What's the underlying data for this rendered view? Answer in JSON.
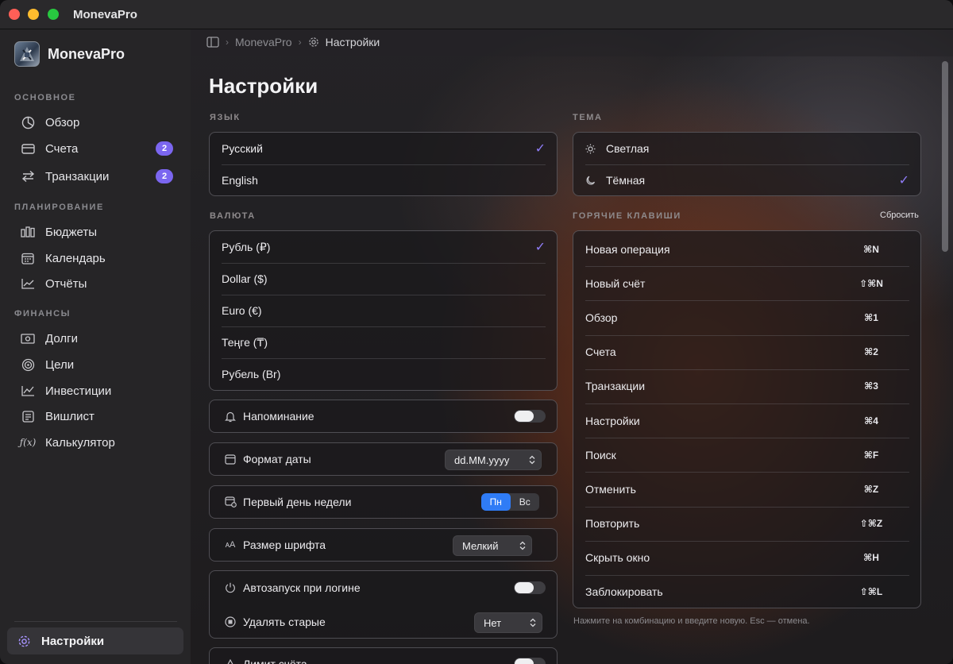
{
  "app": {
    "title": "MonevaPro"
  },
  "sidebar": {
    "brand": "MonevaPro",
    "sections": [
      {
        "title": "ОСНОВНОЕ",
        "items": [
          {
            "label": "Обзор",
            "icon": "pie-chart-icon"
          },
          {
            "label": "Счета",
            "icon": "card-icon",
            "badge": "2"
          },
          {
            "label": "Транзакции",
            "icon": "arrows-icon",
            "badge": "2"
          }
        ]
      },
      {
        "title": "ПЛАНИРОВАНИЕ",
        "items": [
          {
            "label": "Бюджеты",
            "icon": "bars-icon"
          },
          {
            "label": "Календарь",
            "icon": "calendar-icon"
          },
          {
            "label": "Отчёты",
            "icon": "line-chart-icon"
          }
        ]
      },
      {
        "title": "ФИНАНСЫ",
        "items": [
          {
            "label": "Долги",
            "icon": "banknote-icon"
          },
          {
            "label": "Цели",
            "icon": "target-icon"
          },
          {
            "label": "Инвестиции",
            "icon": "trend-icon"
          },
          {
            "label": "Вишлист",
            "icon": "list-icon"
          },
          {
            "label": "Калькулятор",
            "icon": "function-icon"
          }
        ]
      }
    ],
    "settings_label": "Настройки"
  },
  "breadcrumb": {
    "root": "MonevaPro",
    "current": "Настройки"
  },
  "page": {
    "title": "Настройки"
  },
  "language": {
    "title": "ЯЗЫК",
    "options": [
      "Русский",
      "English"
    ],
    "selected": "Русский"
  },
  "theme": {
    "title": "ТЕМА",
    "options": [
      "Светлая",
      "Тёмная"
    ],
    "selected": "Тёмная"
  },
  "currency": {
    "title": "ВАЛЮТА",
    "options": [
      "Рубль (₽)",
      "Dollar ($)",
      "Euro (€)",
      "Теңге (₸)",
      "Рубель (Br)"
    ],
    "selected": "Рубль (₽)"
  },
  "settings": {
    "reminder": {
      "label": "Напоминание",
      "enabled": false
    },
    "date_format": {
      "label": "Формат даты",
      "value": "dd.MM.yyyy"
    },
    "first_day": {
      "label": "Первый день недели",
      "options": [
        "Пн",
        "Вс"
      ],
      "selected": "Пн"
    },
    "font_size": {
      "label": "Размер шрифта",
      "value": "Мелкий"
    },
    "autostart": {
      "label": "Автозапуск при логине",
      "enabled": false
    },
    "delete_old": {
      "label": "Удалять старые",
      "value": "Нет"
    },
    "account_limit": {
      "label": "Лимит счёта"
    }
  },
  "hotkeys": {
    "title": "ГОРЯЧИЕ КЛАВИШИ",
    "reset_label": "Сбросить",
    "items": [
      {
        "label": "Новая операция",
        "key": "⌘N"
      },
      {
        "label": "Новый счёт",
        "key": "⇧⌘N"
      },
      {
        "label": "Обзор",
        "key": "⌘1"
      },
      {
        "label": "Счета",
        "key": "⌘2"
      },
      {
        "label": "Транзакции",
        "key": "⌘3"
      },
      {
        "label": "Настройки",
        "key": "⌘4"
      },
      {
        "label": "Поиск",
        "key": "⌘F"
      },
      {
        "label": "Отменить",
        "key": "⌘Z"
      },
      {
        "label": "Повторить",
        "key": "⇧⌘Z"
      },
      {
        "label": "Скрыть окно",
        "key": "⌘H"
      },
      {
        "label": "Заблокировать",
        "key": "⇧⌘L"
      }
    ],
    "hint": "Нажмите на комбинацию и введите новую. Esc — отмена."
  }
}
